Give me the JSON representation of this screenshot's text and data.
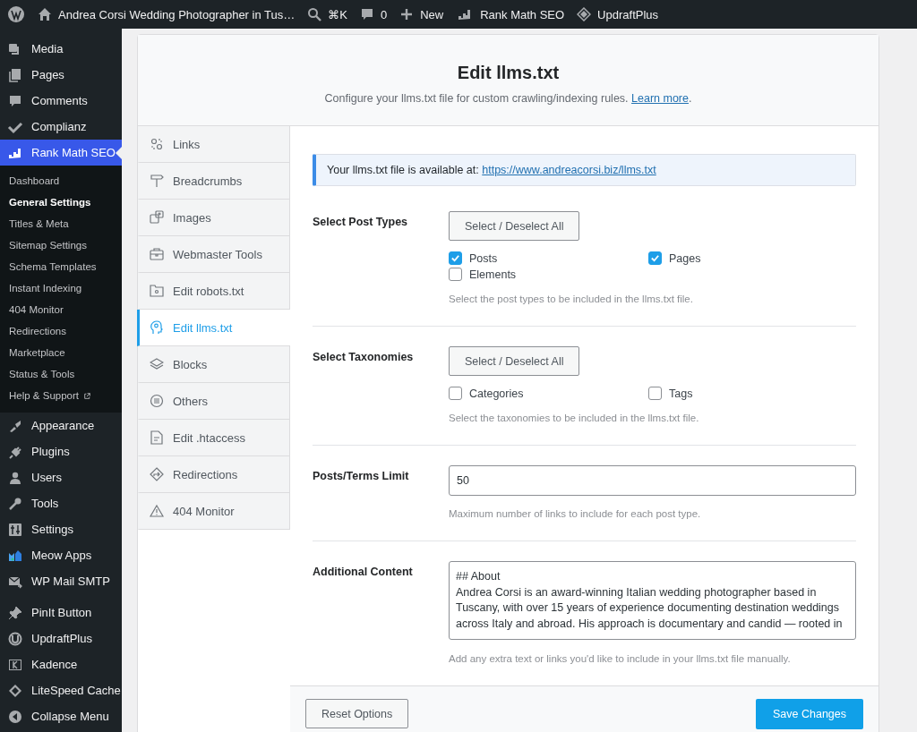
{
  "admin_bar": {
    "items": [
      {
        "label": "Andrea Corsi Wedding Photographer in Tus…"
      },
      {
        "label": "⌘K"
      },
      {
        "label": "0"
      },
      {
        "label": "New"
      },
      {
        "label": "Rank Math SEO"
      },
      {
        "label": "UpdraftPlus"
      }
    ]
  },
  "menu": {
    "groups": [
      {
        "items": [
          {
            "label": "Media",
            "selected": false
          },
          {
            "label": "Pages",
            "selected": false
          },
          {
            "label": "Comments",
            "selected": false
          },
          {
            "label": "Complianz",
            "selected": false
          },
          {
            "label": "Rank Math SEO",
            "selected": true,
            "children": [
              {
                "label": "Dashboard",
                "selected": false
              },
              {
                "label": "General Settings",
                "selected": true
              },
              {
                "label": "Titles & Meta",
                "selected": false
              },
              {
                "label": "Sitemap Settings",
                "selected": false
              },
              {
                "label": "Schema Templates",
                "selected": false
              },
              {
                "label": "Instant Indexing",
                "selected": false
              },
              {
                "label": "404 Monitor",
                "selected": false
              },
              {
                "label": "Redirections",
                "selected": false
              },
              {
                "label": "Marketplace",
                "selected": false
              },
              {
                "label": "Status & Tools",
                "selected": false
              },
              {
                "label": "Help & Support",
                "selected": false
              }
            ]
          },
          {
            "label": "Appearance",
            "selected": false
          },
          {
            "label": "Plugins",
            "selected": false
          },
          {
            "label": "Users",
            "selected": false
          },
          {
            "label": "Tools",
            "selected": false
          },
          {
            "label": "Settings",
            "selected": false
          },
          {
            "label": "Meow Apps",
            "selected": false
          },
          {
            "label": "WP Mail SMTP",
            "selected": false
          }
        ]
      },
      {
        "items": [
          {
            "label": "PinIt Button",
            "selected": false
          },
          {
            "label": "UpdraftPlus",
            "selected": false
          },
          {
            "label": "Kadence",
            "selected": false
          },
          {
            "label": "LiteSpeed Cache",
            "selected": false
          }
        ]
      }
    ],
    "collapse_label": "Collapse Menu"
  },
  "page": {
    "title": "Edit llms.txt",
    "subtitle": "Configure your llms.txt file for custom crawling/indexing rules.",
    "subtitle_link": "Learn more",
    "subtitle_end": "."
  },
  "tabs": [
    {
      "label": "Links",
      "selected": false
    },
    {
      "label": "Breadcrumbs",
      "selected": false
    },
    {
      "label": "Images",
      "selected": false
    },
    {
      "label": "Webmaster Tools",
      "selected": false
    },
    {
      "label": "Edit robots.txt",
      "selected": false
    },
    {
      "label": "Edit llms.txt",
      "selected": true
    },
    {
      "label": "Blocks",
      "selected": false
    },
    {
      "label": "Others",
      "selected": false
    },
    {
      "label": "Edit .htaccess",
      "selected": false
    },
    {
      "label": "Redirections",
      "selected": false
    },
    {
      "label": "404 Monitor",
      "selected": false
    }
  ],
  "notice": {
    "text": "Your llms.txt file is available at:",
    "link": "https://www.andreacorsi.biz/llms.txt"
  },
  "sections": [
    {
      "kind": "checkboxes",
      "label": "Select Post Types",
      "button": "Select / Deselect All",
      "options": [
        {
          "label": "Posts",
          "checked": true
        },
        {
          "label": "Pages",
          "checked": true
        },
        {
          "label": "Elements",
          "checked": false
        }
      ],
      "help": "Select the post types to be included in the llms.txt file."
    },
    {
      "kind": "checkboxes",
      "label": "Select Taxonomies",
      "button": "Select / Deselect All",
      "options": [
        {
          "label": "Categories",
          "checked": false
        },
        {
          "label": "Tags",
          "checked": false
        }
      ],
      "help": "Select the taxonomies to be included in the llms.txt file."
    },
    {
      "kind": "input",
      "label": "Posts/Terms Limit",
      "value": "50",
      "help": "Maximum number of links to include for each post type."
    },
    {
      "kind": "textarea",
      "label": "Additional Content",
      "value": "## About\nAndrea Corsi is an award-winning Italian wedding photographer based in Tuscany, with over 15 years of experience documenting destination weddings across Italy and abroad. His approach is documentary and candid — rooted in",
      "help": "Add any extra text or links you'd like to include in your llms.txt file manually."
    }
  ],
  "footer": {
    "reset": "Reset Options",
    "save": "Save Changes"
  }
}
